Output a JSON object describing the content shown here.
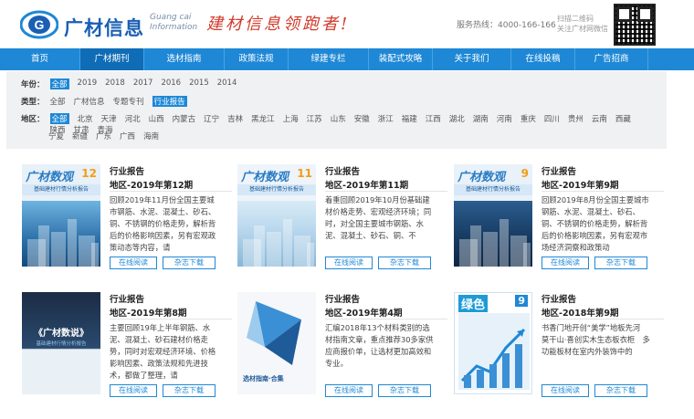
{
  "header": {
    "logo_letter": "G",
    "logo_cn": "广材信息",
    "logo_en_1": "Guang cai",
    "logo_en_2": "Information",
    "slogan": "建材信息领跑者!",
    "hotline": "服务热线：4000-166-166",
    "qr_line1": "扫描二维码",
    "qr_line2": "关注广材网微信"
  },
  "nav": [
    {
      "label": "首页",
      "w": 88
    },
    {
      "label": "广材期刊",
      "w": 70
    },
    {
      "label": "选材指南",
      "w": 88
    },
    {
      "label": "政策法规",
      "w": 70
    },
    {
      "label": "绿建专栏",
      "w": 88
    },
    {
      "label": "装配式攻略",
      "w": 70
    },
    {
      "label": "关于我们",
      "w": 86
    },
    {
      "label": "在线投稿",
      "w": 70
    },
    {
      "label": "广告招商",
      "w": 80
    }
  ],
  "filters": {
    "year_label": "年份：",
    "years": [
      "全部",
      "2019",
      "2018",
      "2017",
      "2016",
      "2015",
      "2014"
    ],
    "type_label": "类型：",
    "types": [
      "全部",
      "广材信息",
      "专题专刊",
      "行业报告"
    ],
    "region_label": "地区：",
    "regions": [
      "全部",
      "北京",
      "天津",
      "河北",
      "山西",
      "内蒙古",
      "辽宁",
      "吉林",
      "黑龙江",
      "上海",
      "江苏",
      "山东",
      "安徽",
      "浙江",
      "福建",
      "江西",
      "湖北",
      "湖南",
      "河南",
      "重庆",
      "四川",
      "贵州",
      "云南",
      "西藏",
      "陕西",
      "甘肃",
      "青海"
    ],
    "regions2": [
      "宁夏",
      "新疆",
      "广东",
      "广西",
      "海南"
    ]
  },
  "cards": [
    {
      "title": "行业报告",
      "subtitle": "地区-2019年第12期",
      "desc": "回顾2019年11月份全国主要城市钢筋、水泥、混凝土、砂石、铜、不锈钢的价格走势，解析背后的价格影响因素，另有宏观政策动态等内容，请",
      "cover_title": "广材数观",
      "cover_num": "12",
      "cover_band": "基础建材行情分析报告",
      "read": "在线阅读",
      "download": "杂志下载"
    },
    {
      "title": "行业报告",
      "subtitle": "地区-2019年第11期",
      "desc": "着重回顾2019年10月份基础建材价格走势、宏观经济环境；同时，对全国主要城市钢筋、水泥、混凝土、砂石、铜、不",
      "cover_title": "广材数观",
      "cover_num": "11",
      "cover_band": "基础建材行情分析报告",
      "read": "在线阅读",
      "download": "杂志下载"
    },
    {
      "title": "行业报告",
      "subtitle": "地区-2019年第9期",
      "desc": "回顾2019年8月份全国主要城市钢筋、水泥、混凝土、砂石、铜、不锈钢的价格走势，解析背后的价格影响因素，另有宏观市场经济洞察和政策动",
      "cover_title": "广材数观",
      "cover_num": "9",
      "cover_band": "基础建材行情分析报告",
      "read": "在线阅读",
      "download": "杂志下载"
    },
    {
      "title": "行业报告",
      "subtitle": "地区-2019年第8期",
      "desc": "主要回顾19年上半年钢筋、水泥、混凝土、砂石建材价格走势，同时对宏观经济环境、价格影响因素、政策法规和先进技术，都做了整理，请",
      "cover_title": "《广材数说》",
      "cover_num": "",
      "cover_band": "基础建材行情分析报告",
      "read": "在线阅读",
      "download": "杂志下载"
    },
    {
      "title": "行业报告",
      "subtitle": "地区-2019年第4期",
      "desc": "汇编2018年13个材料类别的选材指南文章，重点推荐30多家供应商报价单，让选材更加高效和专业。",
      "cover_title": "选材指南·合集",
      "cover_num": "",
      "cover_band": "",
      "read": "在线阅读",
      "download": "杂志下载"
    },
    {
      "title": "行业报告",
      "subtitle": "地区-2018年第9期",
      "desc": "书香门地开创“美学”地板先河　莫干山·喜创实木生态板衣柜　多功能板材在室内外装饰中的",
      "cover_title": "绿色",
      "cover_num": "9",
      "cover_band": "",
      "read": "在线阅读",
      "download": "杂志下载"
    }
  ],
  "colors": {
    "nav_bg": "#1e88d6",
    "accent": "#1e88d6",
    "slogan": "#d23a2a",
    "logo": "#1a5fb4"
  }
}
